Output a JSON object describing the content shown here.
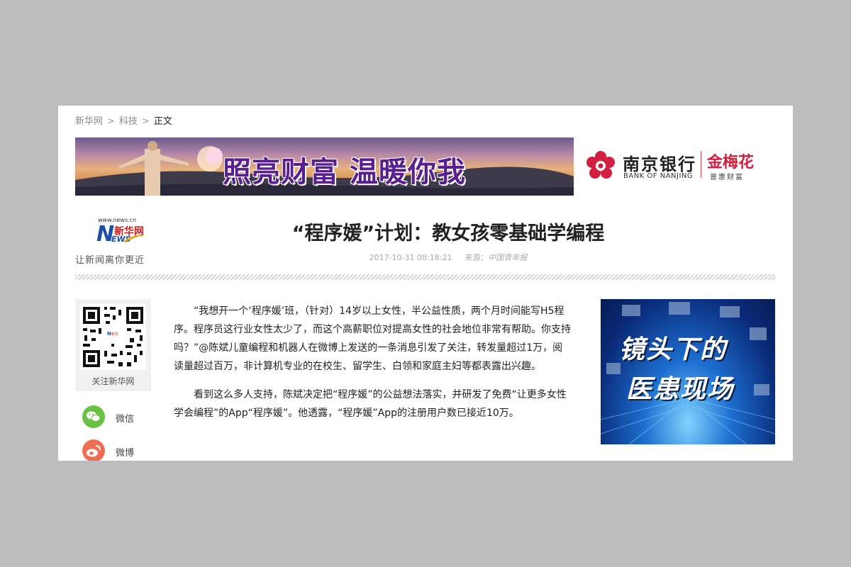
{
  "breadcrumb": {
    "items": [
      "新华网",
      "科技",
      "正文"
    ],
    "separator": ">"
  },
  "banner": {
    "slogan": "照亮财富 温暖你我",
    "bank_name": "南京银行",
    "bank_name_en": "BANK OF NANJING",
    "product_name": "金梅花",
    "product_tag": "普惠财富",
    "bank_color": "#d11f3f"
  },
  "site_logo": {
    "domain": "www.news.cn",
    "name": "新华网",
    "mark_letter": "N",
    "mark_rest": "EWS",
    "slogan": "让新闻离你更近"
  },
  "article": {
    "title": "“程序媛”计划：教女孩零基础学编程",
    "datetime": "2017-10-31 08:18:21",
    "source_label": "来源：",
    "source": "中国青年报",
    "paragraphs": [
      "“我想开一个‘程序媛’班，（针对）14岁以上女性，半公益性质，两个月时间能写H5程序。程序员这行业女性太少了，而这个高薪职位对提高女性的社会地位非常有帮助。你支持吗？”@陈斌儿童编程和机器人在微博上发送的一条消息引发了关注，转发量超过1万，阅读量超过百万，非计算机专业的在校生、留学生、白领和家庭主妇等都表露出兴趣。",
      "看到这么多人支持，陈斌决定把“程序媛”的公益想法落实，并研发了免费“让更多女性学会编程”的App“程序媛”。他透露，“程序媛”App的注册用户数已接近10万。"
    ]
  },
  "share": {
    "qr_caption": "关注新华网",
    "wechat_label": "微信",
    "weibo_label": "微博",
    "wechat_icon": "wechat-icon",
    "weibo_icon": "weibo-icon"
  },
  "side_ad": {
    "line1": "镜头下的",
    "line2": "医患现场"
  }
}
